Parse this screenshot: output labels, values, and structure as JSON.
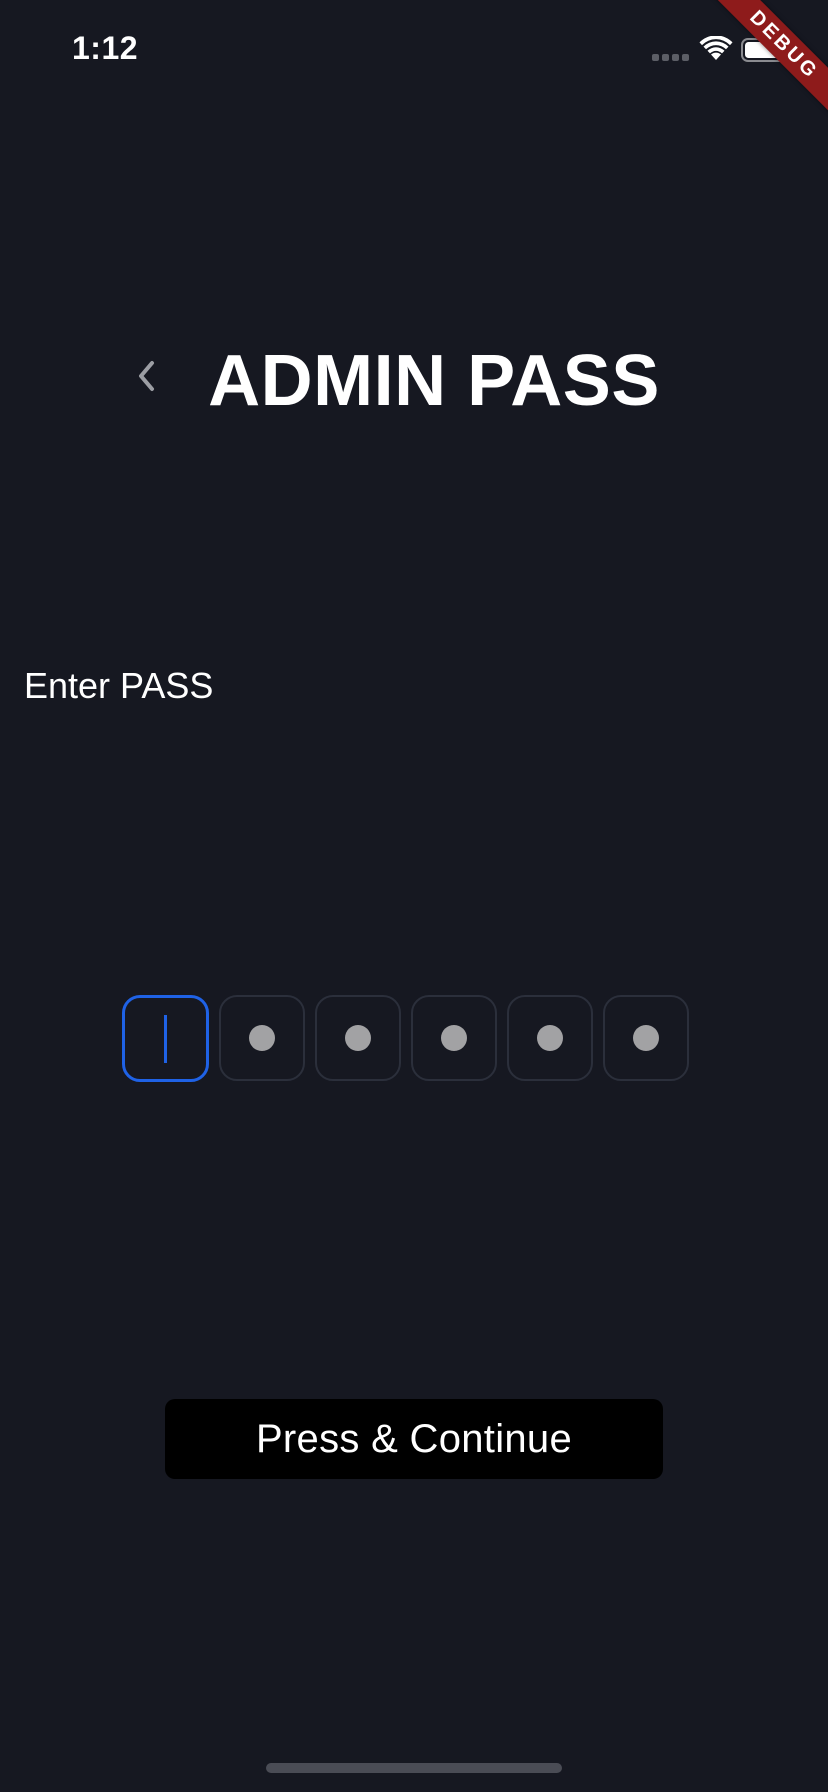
{
  "status_bar": {
    "time": "1:12",
    "signal_icon": "cellular-signal-icon",
    "wifi_icon": "wifi-icon",
    "battery_icon": "battery-icon"
  },
  "debug_banner": {
    "label": "DEBUG",
    "color": "#8e1b1b"
  },
  "header": {
    "back_icon": "chevron-left-icon",
    "title": "ADMIN PASS"
  },
  "form": {
    "label": "Enter PASS",
    "pin_length": 6,
    "focused_index": 0,
    "active_color": "#1f62e6"
  },
  "actions": {
    "continue_label": "Press & Continue"
  },
  "colors": {
    "background": "#161821",
    "button": "#000000",
    "text": "#ffffff"
  }
}
